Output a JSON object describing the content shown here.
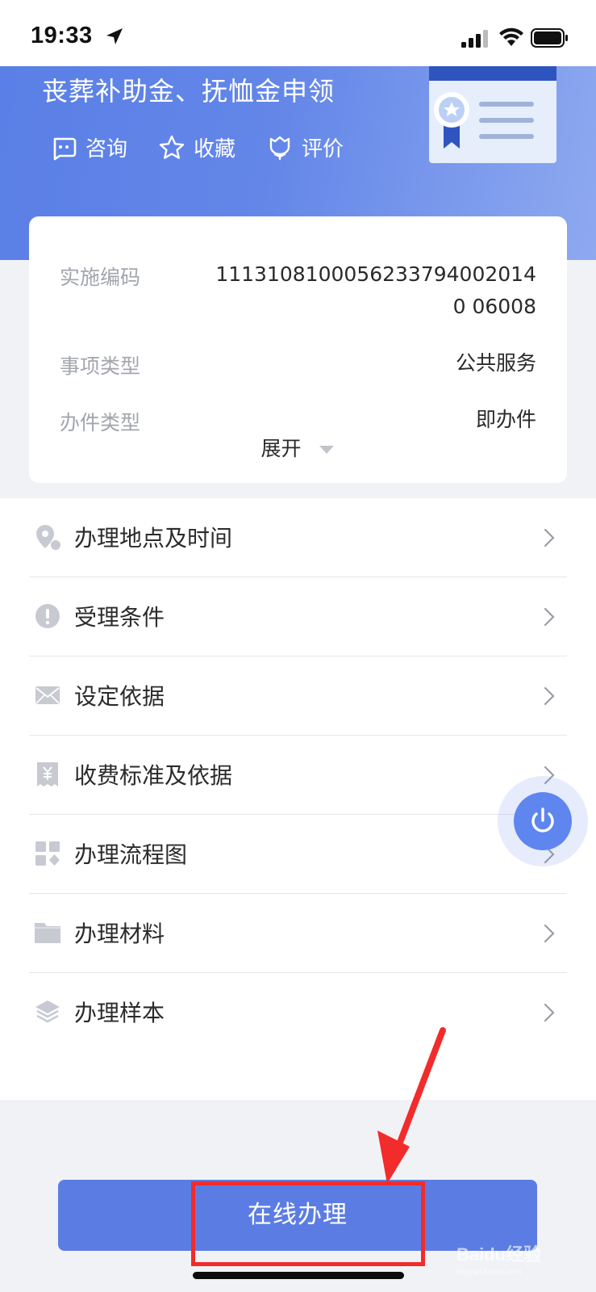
{
  "status_bar": {
    "time": "19:33"
  },
  "header": {
    "title": "丧葬补助金、抚恤金申领",
    "actions": [
      {
        "label": "咨询",
        "icon": "chat-icon"
      },
      {
        "label": "收藏",
        "icon": "star-icon"
      },
      {
        "label": "评价",
        "icon": "tulip-icon"
      }
    ]
  },
  "info": {
    "rows": [
      {
        "label": "实施编码",
        "value": "11131081000562337940020140 06008"
      },
      {
        "label": "事项类型",
        "value": "公共服务"
      },
      {
        "label": "办件类型",
        "value": "即办件"
      }
    ],
    "expand_label": "展开"
  },
  "menu": {
    "items": [
      {
        "label": "办理地点及时间",
        "icon": "location-icon"
      },
      {
        "label": "受理条件",
        "icon": "exclamation-icon"
      },
      {
        "label": "设定依据",
        "icon": "envelope-icon"
      },
      {
        "label": "收费标准及依据",
        "icon": "receipt-yen-icon"
      },
      {
        "label": "办理流程图",
        "icon": "flowchart-icon"
      },
      {
        "label": "办理材料",
        "icon": "folder-icon"
      },
      {
        "label": "办理样本",
        "icon": "layers-icon"
      }
    ]
  },
  "bottom": {
    "primary_button": "在线办理"
  },
  "watermark": {
    "text": "Baidu经验",
    "sub": "jingyan.baidu.com"
  },
  "colors": {
    "primary": "#5b7de3",
    "header_gradient_start": "#5a7fe6",
    "annotation_red": "#f22b2b"
  }
}
